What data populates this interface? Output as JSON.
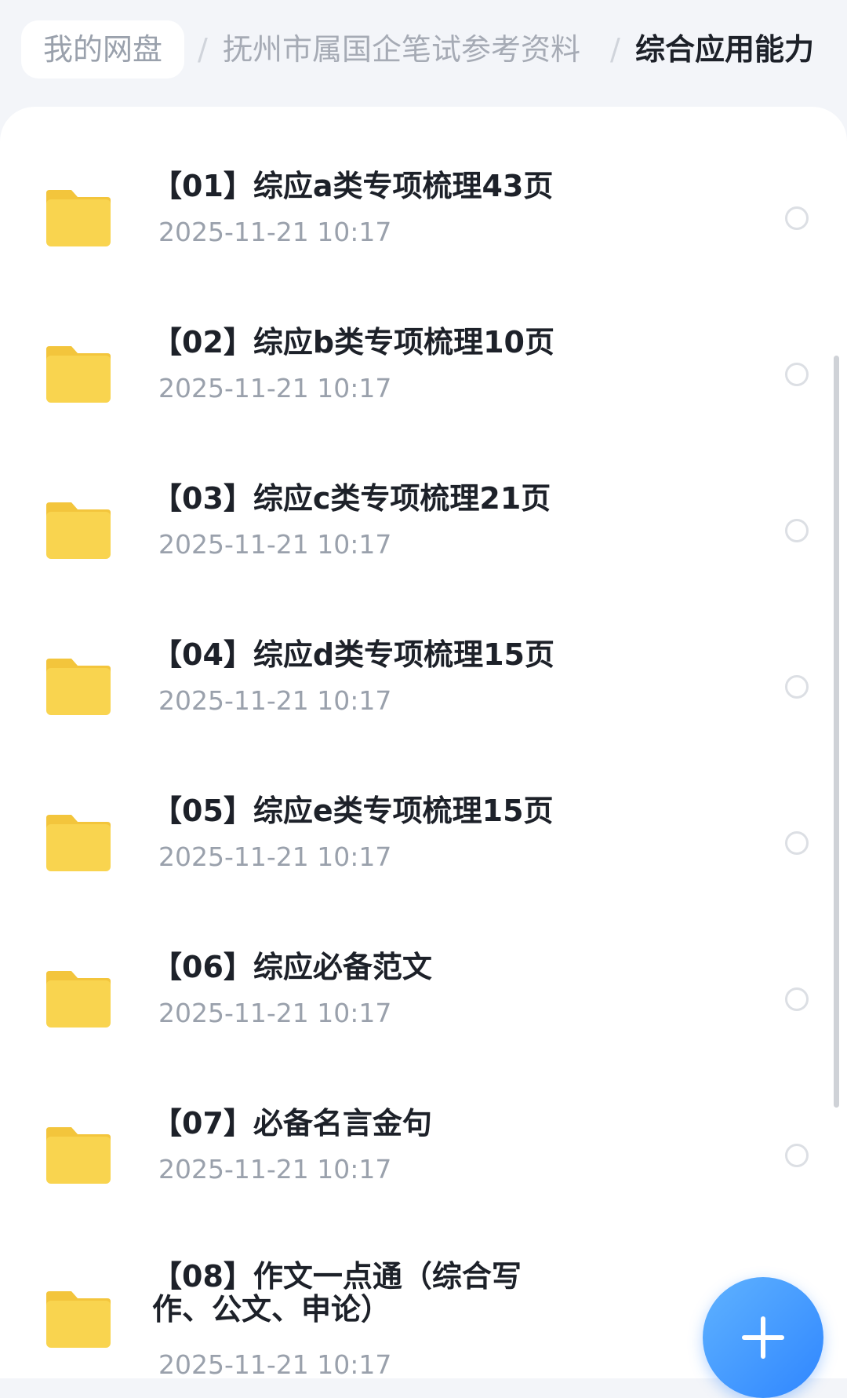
{
  "breadcrumb": {
    "root": "我的网盘",
    "separator": "/",
    "parent": "抚州市属国企笔试参考资料",
    "current": "综合应用能力"
  },
  "colors": {
    "folder": "#f9d44f",
    "folder_tab": "#f3c53c",
    "accent": "#2f86ff"
  },
  "files": [
    {
      "name": "【01】综应a类专项梳理43页",
      "date": "2025-11-21 10:17",
      "icon": "folder-icon"
    },
    {
      "name": "【02】综应b类专项梳理10页",
      "date": "2025-11-21 10:17",
      "icon": "folder-icon"
    },
    {
      "name": "【03】综应c类专项梳理21页",
      "date": "2025-11-21 10:17",
      "icon": "folder-icon"
    },
    {
      "name": "【04】综应d类专项梳理15页",
      "date": "2025-11-21 10:17",
      "icon": "folder-icon"
    },
    {
      "name": "【05】综应e类专项梳理15页",
      "date": "2025-11-21 10:17",
      "icon": "folder-icon"
    },
    {
      "name": "【06】综应必备范文",
      "date": "2025-11-21 10:17",
      "icon": "folder-icon"
    },
    {
      "name": "【07】必备名言金句",
      "date": "2025-11-21 10:17",
      "icon": "folder-icon"
    },
    {
      "name": "【08】作文一点通（综合写作、公文、申论）",
      "date": "2025-11-21 10:17",
      "icon": "folder-icon"
    }
  ],
  "fab": {
    "icon": "plus-icon"
  }
}
